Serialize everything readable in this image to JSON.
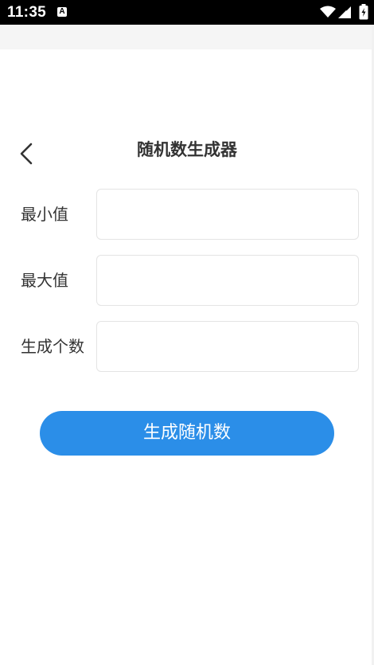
{
  "status_bar": {
    "time": "11:35",
    "icons": [
      "a-notification-icon",
      "wifi-icon",
      "signal-icon",
      "battery-icon"
    ]
  },
  "header": {
    "title": "随机数生成器",
    "back_icon": "chevron-left-icon"
  },
  "form": {
    "min_label": "最小值",
    "min_value": "",
    "min_placeholder": "",
    "max_label": "最大值",
    "max_value": "",
    "max_placeholder": "",
    "count_label": "生成个数",
    "count_value": "",
    "count_placeholder": ""
  },
  "actions": {
    "generate_label": "生成随机数"
  },
  "colors": {
    "primary": "#2b8ee8",
    "text": "#333333",
    "border": "#e4e4e4",
    "status_bar": "#000000",
    "strip": "#f5f5f5"
  }
}
